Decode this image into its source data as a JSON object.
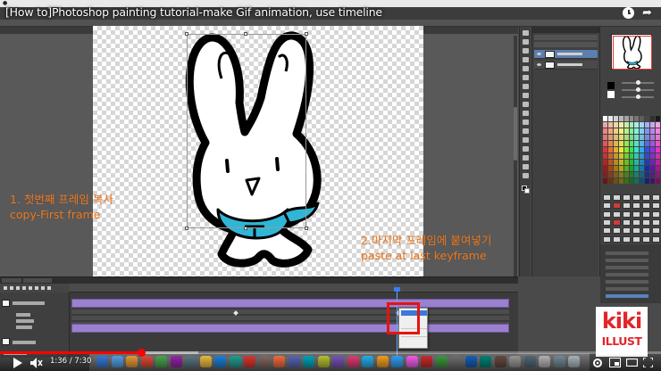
{
  "video": {
    "title": "[How to]Photoshop painting tutorial-make Gif animation, use timeline",
    "time": "1:36 / 7:30",
    "progress": 0.213,
    "buffered": 0.3
  },
  "captions": {
    "step1_ko": "1. 첫번째 프레임 복사",
    "step1_en": "copy-First frame",
    "step2_ko": "2.마지막 프레임에 붙여넣기",
    "step2_en": "paste at last keyframe"
  },
  "logo": {
    "top": "kiki",
    "bottom": "ILLUST",
    "color": "#e1262b"
  },
  "colors": {
    "caption": "#f07a20",
    "scarf": "#2fb6d6",
    "track": "#9b80cf",
    "highlight_box": "#e8130e",
    "progress": "#ff0000"
  },
  "icons": {
    "top_right": [
      "watch-later-icon",
      "share-icon"
    ],
    "player": [
      "play-icon",
      "mute-icon",
      "settings-icon",
      "miniplayer-icon",
      "theater-icon",
      "fullscreen-icon"
    ]
  }
}
